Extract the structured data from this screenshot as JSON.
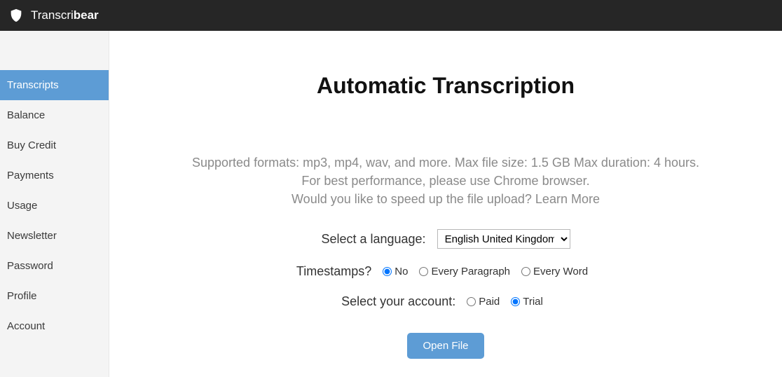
{
  "header": {
    "brand_prefix": "Transcri",
    "brand_bold": "bear"
  },
  "sidebar": {
    "items": [
      {
        "label": "Transcripts",
        "active": true
      },
      {
        "label": "Balance",
        "active": false
      },
      {
        "label": "Buy Credit",
        "active": false
      },
      {
        "label": "Payments",
        "active": false
      },
      {
        "label": "Usage",
        "active": false
      },
      {
        "label": "Newsletter",
        "active": false
      },
      {
        "label": "Password",
        "active": false
      },
      {
        "label": "Profile",
        "active": false
      },
      {
        "label": "Account",
        "active": false
      }
    ]
  },
  "main": {
    "title": "Automatic Transcription",
    "desc_line1": "Supported formats: mp3, mp4, wav, and more. Max file size: 1.5 GB Max duration: 4 hours.",
    "desc_line2": "For best performance, please use Chrome browser.",
    "desc_line3": "Would you like to speed up the file upload? Learn More",
    "language": {
      "label": "Select a language:",
      "selected": "English United Kingdom",
      "options": [
        "English United Kingdom"
      ]
    },
    "timestamps": {
      "label": "Timestamps?",
      "options": [
        {
          "label": "No",
          "value": "no",
          "checked": true
        },
        {
          "label": "Every Paragraph",
          "value": "para",
          "checked": false
        },
        {
          "label": "Every Word",
          "value": "word",
          "checked": false
        }
      ]
    },
    "account": {
      "label": "Select your account:",
      "options": [
        {
          "label": "Paid",
          "value": "paid",
          "checked": false
        },
        {
          "label": "Trial",
          "value": "trial",
          "checked": true
        }
      ]
    },
    "open_file_label": "Open File"
  }
}
